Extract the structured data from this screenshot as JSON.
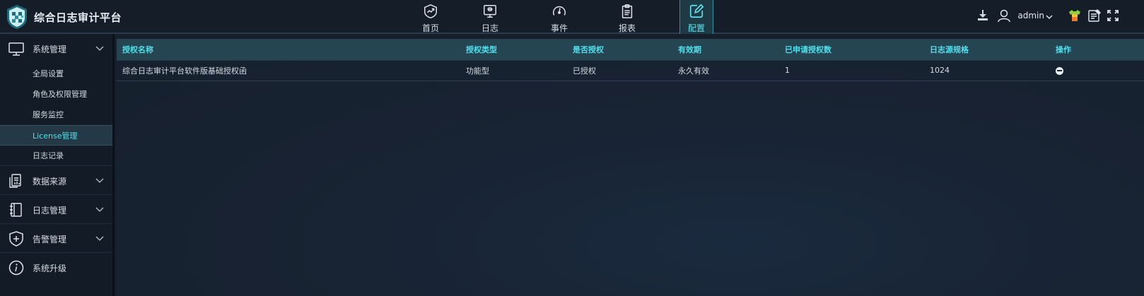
{
  "app": {
    "title": "综合日志审计平台"
  },
  "nav": {
    "items": [
      {
        "label": "首页",
        "icon": "trend-chart-icon"
      },
      {
        "label": "日志",
        "icon": "monitor-log-icon"
      },
      {
        "label": "事件",
        "icon": "gauge-icon"
      },
      {
        "label": "报表",
        "icon": "clipboard-icon"
      },
      {
        "label": "配置",
        "icon": "edit-config-icon",
        "active": true
      }
    ]
  },
  "toolbar": {
    "user": "admin",
    "icons": [
      "download-icon",
      "user-icon",
      "theme-shirt-icon",
      "notes-icon",
      "fullscreen-icon"
    ]
  },
  "sidebar": {
    "groups": [
      {
        "label": "系统管理",
        "icon": "monitor-icon",
        "expanded": true,
        "items": [
          {
            "label": "全局设置"
          },
          {
            "label": "角色及权限管理"
          },
          {
            "label": "服务监控"
          },
          {
            "label": "License管理",
            "active": true
          },
          {
            "label": "日志记录"
          }
        ]
      },
      {
        "label": "数据来源",
        "icon": "data-source-icon"
      },
      {
        "label": "日志管理",
        "icon": "notebook-icon"
      },
      {
        "label": "告警管理",
        "icon": "shield-plus-icon"
      },
      {
        "label": "系统升级",
        "icon": "info-icon"
      }
    ]
  },
  "table": {
    "columns": [
      "授权名称",
      "授权类型",
      "是否授权",
      "有效期",
      "已申请授权数",
      "日志源规格",
      "操作"
    ],
    "rows": [
      [
        "综合日志审计平台软件版基础授权函",
        "功能型",
        "已授权",
        "永久有效",
        "1",
        "1024",
        ""
      ]
    ]
  },
  "colors": {
    "accent": "#4fe0ec",
    "header_bg": "#244551",
    "background": "#161f2b"
  }
}
